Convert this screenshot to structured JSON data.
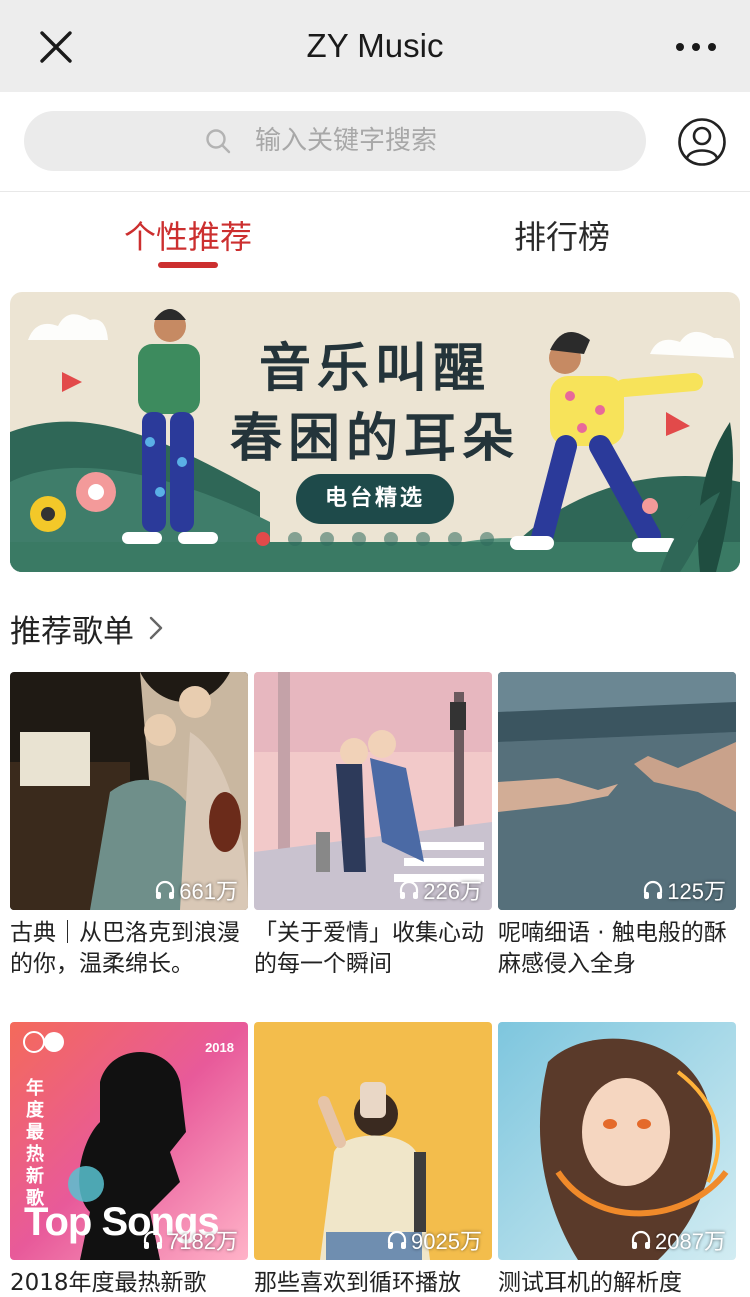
{
  "navbar": {
    "title": "ZY Music",
    "close_icon": "close-icon",
    "more_icon": "more-icon"
  },
  "search": {
    "placeholder": "输入关键字搜索",
    "value": ""
  },
  "tabs": [
    {
      "label": "个性推荐",
      "active": true
    },
    {
      "label": "排行榜",
      "active": false
    }
  ],
  "banner": {
    "line1": "音乐叫醒",
    "line2": "春困的耳朵",
    "pill": "电台精选",
    "slide_count": 8,
    "active_slide": 0
  },
  "section": {
    "title": "推荐歌单"
  },
  "playlists": [
    {
      "title": "古典｜从巴洛克到浪漫的你，温柔绵长。",
      "plays": "661万"
    },
    {
      "title": "「关于爱情」收集心动的每一个瞬间",
      "plays": "226万"
    },
    {
      "title": "呢喃细语 · 触电般的酥麻感侵入全身",
      "plays": "125万"
    },
    {
      "title": "2018年度最热新歌",
      "plays": "7182万",
      "cover_text": {
        "year": "2018",
        "vertical": "年度最热新歌",
        "big": "Top Songs"
      }
    },
    {
      "title": "那些喜欢到循环播放",
      "plays": "9025万"
    },
    {
      "title": "测试耳机的解析度",
      "plays": "2087万"
    }
  ],
  "colors": {
    "accent": "#cc2f2f",
    "navbar_bg": "#ededed",
    "search_bg": "#ebebeb"
  }
}
